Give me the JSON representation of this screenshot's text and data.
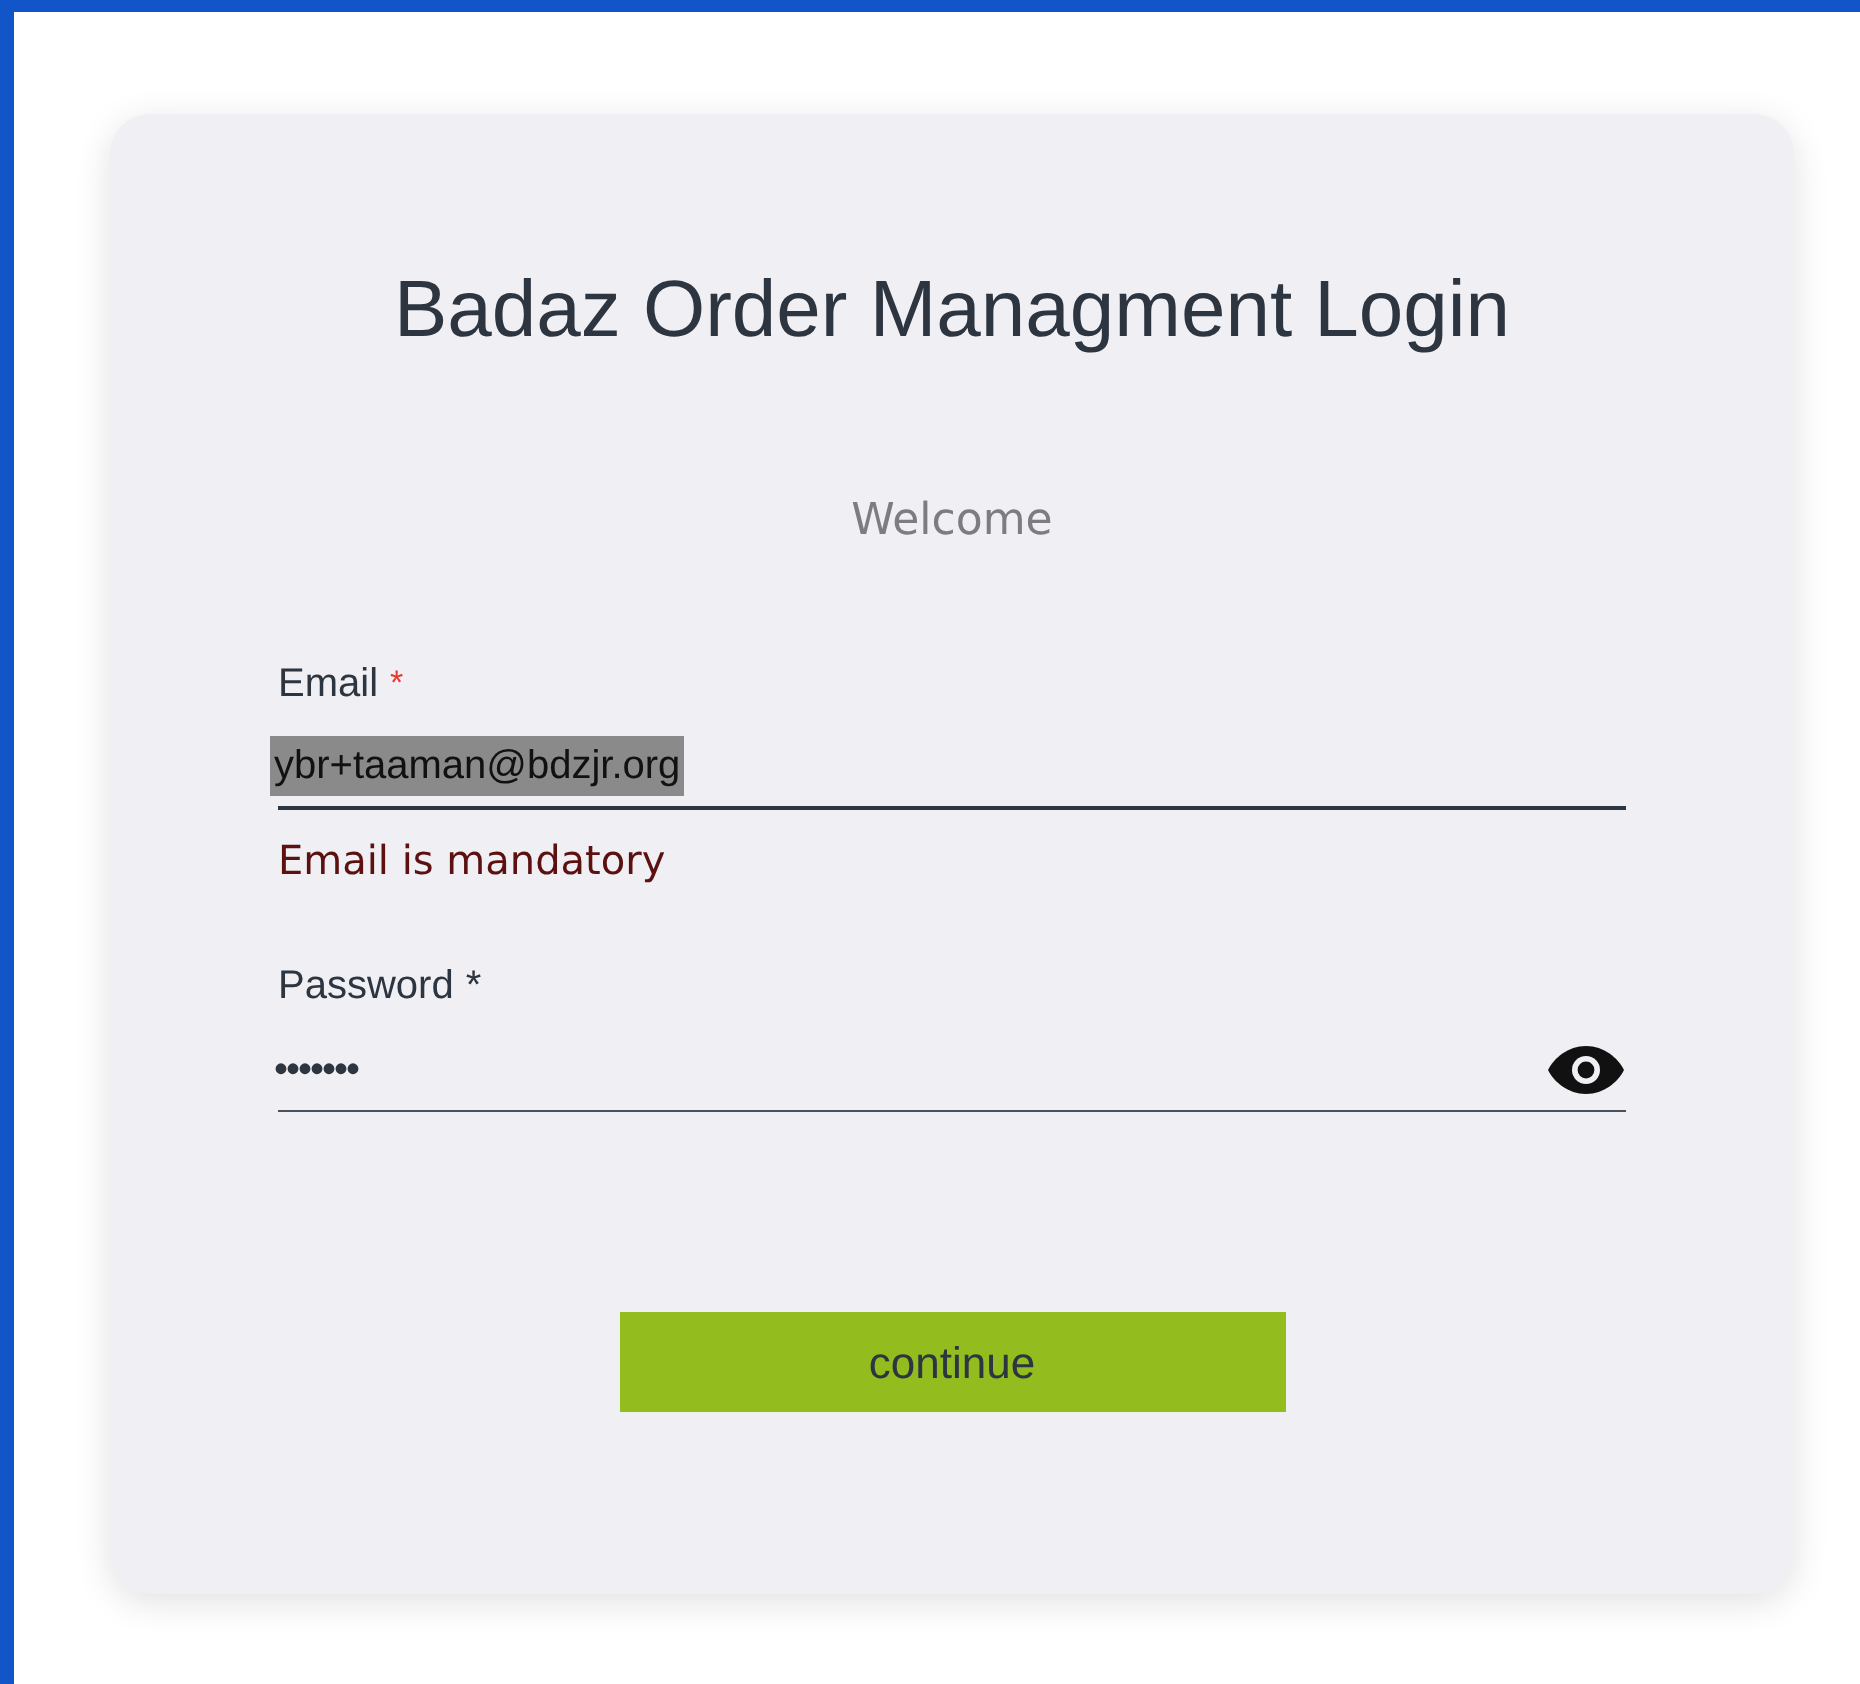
{
  "title": "Badaz Order Managment Login",
  "subtitle": "Welcome",
  "fields": [
    {
      "kind": "email",
      "label": "Email",
      "required_mark": "*",
      "value": "ybr+taaman@bdzjr.org",
      "selected": true,
      "invalid": true,
      "error": "Email is mandatory"
    },
    {
      "kind": "password",
      "label": "Password",
      "required_mark": "*",
      "value": "•••••••",
      "selected": false,
      "invalid": false
    }
  ],
  "button": "continue"
}
